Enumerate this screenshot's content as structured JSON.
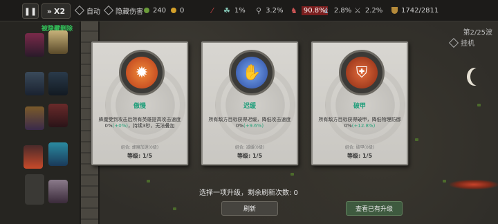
{
  "topbar": {
    "pause_icon": "pause-icon",
    "speed_label": "X2",
    "auto_label": "自动",
    "hide_damage_label": "隐藏伤害",
    "green_currency": "240",
    "gold_currency": "0",
    "stats": [
      {
        "icon": "crossbow-icon",
        "value": ""
      },
      {
        "icon": "archer-icon",
        "value": "1%"
      },
      {
        "icon": "runner-icon",
        "value": "3.2%"
      },
      {
        "icon": "warrior-icon",
        "value": "90.8%"
      },
      {
        "icon": "mage-icon",
        "value": "2.8%"
      },
      {
        "icon": "rogue-icon",
        "value": "2.2%"
      }
    ],
    "hp": "1742/2811"
  },
  "left": {
    "label": "被隐藏删除"
  },
  "wave": {
    "text": "第2/25波",
    "hang_label": "挂机"
  },
  "cards": [
    {
      "name": "傲慢",
      "desc_prefix": "蜂魔受到攻击后所有英雄提高攻击速度0%",
      "desc_hl": "(+0%)",
      "desc_suffix": "，持续3秒，无法叠加",
      "sub": "组合: 蜂魔加速(0级)",
      "level": "等级: 1/5",
      "icon": "pride-beast-icon",
      "color": "#e0662a"
    },
    {
      "name": "迟缓",
      "desc_prefix": "所有敌方目标获得迟缓，降低攻击速度0%",
      "desc_hl": "(+9.6%)",
      "desc_suffix": "",
      "sub": "组合: 减缓(0级)",
      "level": "等级: 1/5",
      "icon": "slow-chain-icon",
      "color": "#3d6fd0"
    },
    {
      "name": "破甲",
      "desc_prefix": "所有敌方目标获得破甲，降低物理防御0%",
      "desc_hl": "(+12.8%)",
      "desc_suffix": "",
      "sub": "组合: 破甲(0级)",
      "level": "等级: 1/5",
      "icon": "armor-break-icon",
      "color": "#c2401f"
    }
  ],
  "prompt": "选择一项升级，剩余刷新次数: 0",
  "buttons": {
    "refresh": "刷新",
    "view_upgrades": "查看已有升级"
  }
}
